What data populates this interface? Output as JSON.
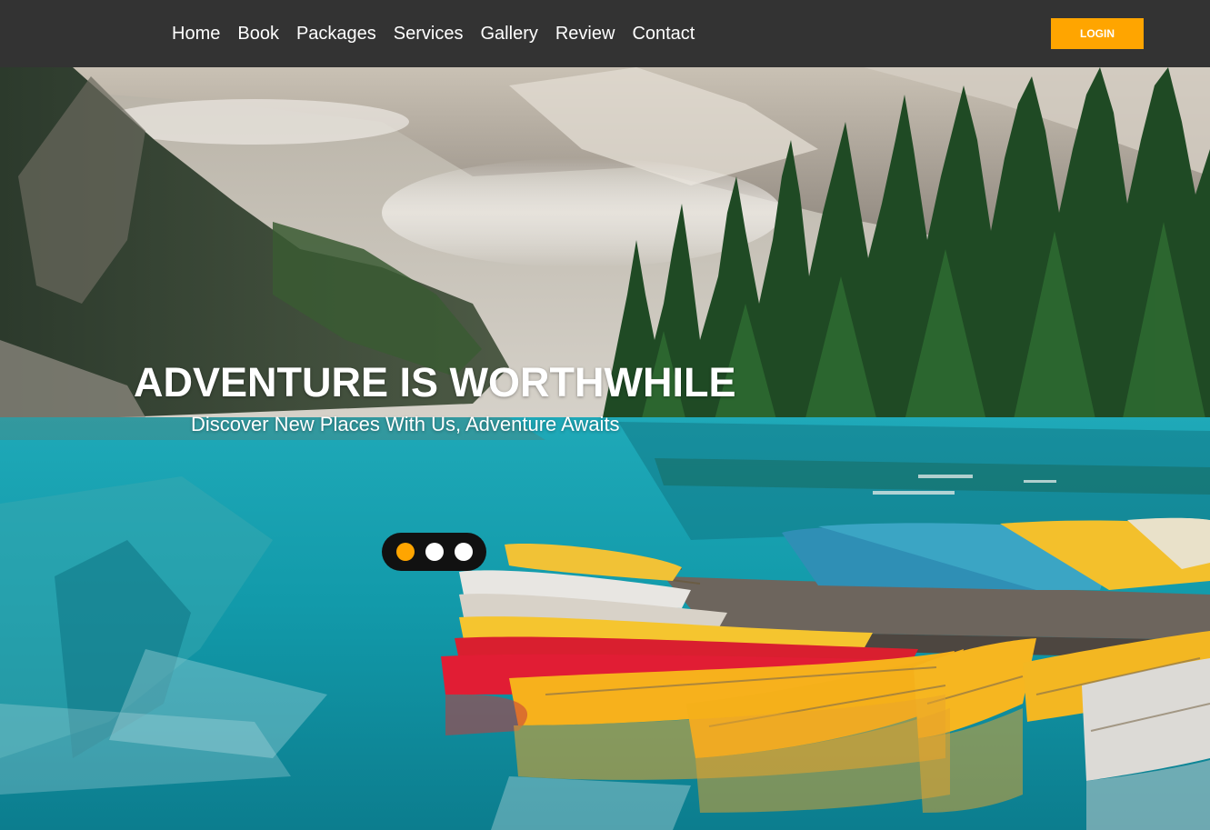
{
  "colors": {
    "navbar_bg": "#333333",
    "accent": "#ffa500",
    "dot_inactive": "#ffffff",
    "text": "#ffffff"
  },
  "nav": {
    "links": [
      "Home",
      "Book",
      "Packages",
      "Services",
      "Gallery",
      "Review",
      "Contact"
    ],
    "login_label": "LOGIN"
  },
  "hero": {
    "title": "ADVENTURE IS WORTHWHILE",
    "subtitle": "Discover New Places With Us, Adventure Awaits",
    "background": "mountain lake with canoes",
    "slides": 3,
    "active_slide": 1
  }
}
